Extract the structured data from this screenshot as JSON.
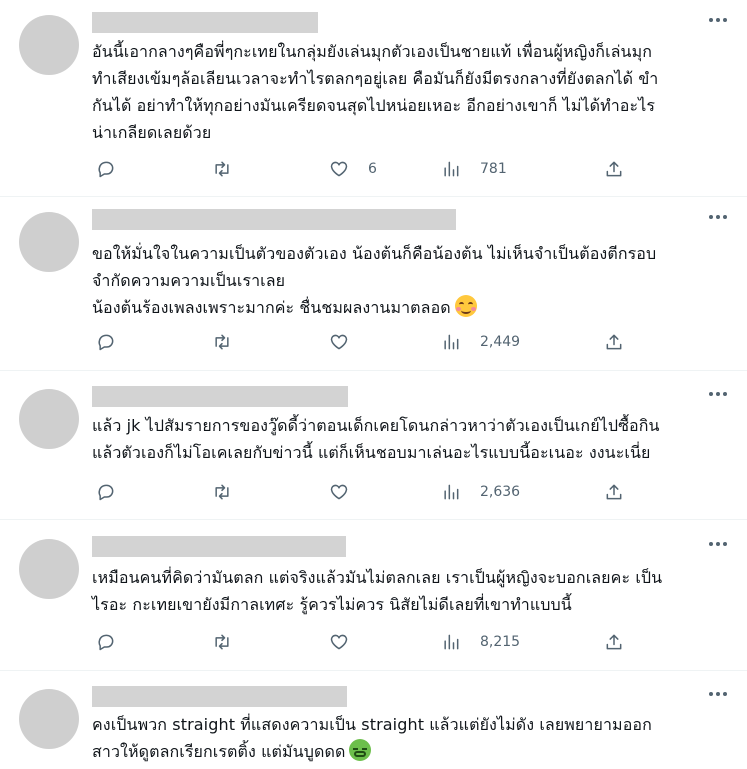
{
  "tweets": [
    {
      "lines": [
        "อันนี้เอากลางๆคือพี่ๆกะเทยในกลุ่มยังเล่นมุกตัวเองเป็นชายแท้ เพื่อนผู้หญิงก็เล่นมุก",
        "ทำเสียงเข้มๆล้อเลียนเวลาจะทำไรตลกๆอยู่เลย คือมันก็ยังมีตรงกลางที่ยังตลกได้ ขำ",
        "กันได้ อย่าทำให้ทุกอย่างมันเครียดจนสุดไปหน่อยเหอะ อีกอย่างเขาก็ ไม่ได้ทำอะไร",
        "น่าเกลียดเลยด้วย"
      ],
      "replies": "",
      "retweets": "",
      "likes": "6",
      "views": "781"
    },
    {
      "lines": [
        "ขอให้มั่นใจในความเป็นตัวของตัวเอง น้องต้นก็คือน้องต้น ไม่เห็นจำเป็นต้องตีกรอบ",
        "จำกัดความความเป็นเราเลย",
        "น้องต้นร้องเพลงเพราะมากค่ะ ชื่นชมผลงานมาตลอด"
      ],
      "emoji": "smiling-face-emoji",
      "replies": "",
      "retweets": "",
      "likes": "",
      "views": "2,449"
    },
    {
      "lines": [
        "แล้ว jk ไปสัมรายการของวู๊ดดี้ว่าตอนเด็กเคยโดนกล่าวหาว่าตัวเองเป็นเกย์ไปซื้อกิน",
        "แล้วตัวเองก็ไม่โอเคเลยกับข่าวนี้ แต่ก็เห็นชอบมาเล่นอะไรแบบนี้อะเนอะ งงนะเนี่ย"
      ],
      "replies": "",
      "retweets": "",
      "likes": "",
      "views": "2,636"
    },
    {
      "lines": [
        "เหมือนคนที่คิดว่ามันตลก แต่จริงแล้วมันไม่ตลกเลย เราเป็นผู้หญิงจะบอกเลยคะ เป็น",
        "ไรอะ  กะเทยเขายังมีกาลเทศะ รู้ควรไม่ควร  นิสัยไม่ดีเลยที่เขาทำแบบนี้"
      ],
      "replies": "",
      "retweets": "",
      "likes": "",
      "views": "8,215"
    },
    {
      "lines": [
        "คงเป็นพวก straight ที่แสดงความเป็น straight แล้วแต่ยังไม่ดัง เลยพยายามออก",
        "สาวให้ดูตลกเรียกเรตติ้ง แต่มันบูดดด"
      ],
      "emoji": "nauseated-face-emoji",
      "replies": "",
      "retweets": "",
      "likes": "",
      "views": ""
    }
  ]
}
